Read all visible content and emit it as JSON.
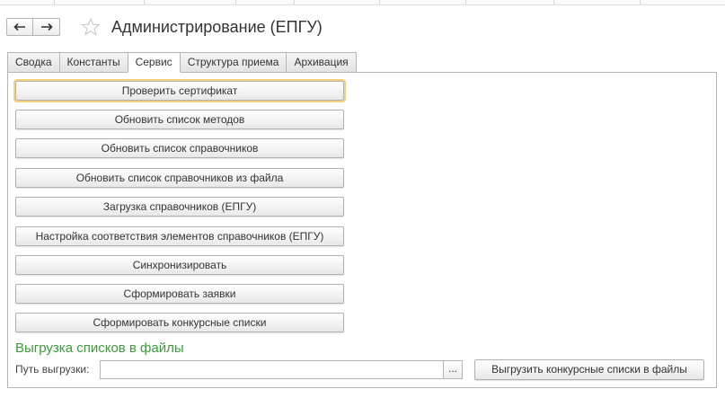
{
  "header": {
    "back_icon": "arrow-left-icon",
    "forward_icon": "arrow-right-icon",
    "favorite_icon": "star-outline-icon",
    "title": "Администрирование (ЕПГУ)"
  },
  "tabs": [
    {
      "label": "Сводка",
      "active": false
    },
    {
      "label": "Константы",
      "active": false
    },
    {
      "label": "Сервис",
      "active": true
    },
    {
      "label": "Структура приема",
      "active": false
    },
    {
      "label": "Архивация",
      "active": false
    }
  ],
  "service": {
    "buttons": [
      {
        "label": "Проверить сертификат",
        "focused": true
      },
      {
        "label": "Обновить список методов",
        "focused": false
      },
      {
        "label": "Обновить список справочников",
        "focused": false
      },
      {
        "label": "Обновить список справочников из файла",
        "focused": false
      },
      {
        "label": "Загрузка справочников (ЕПГУ)",
        "focused": false
      },
      {
        "label": "Настройка соответствия элементов справочников (ЕПГУ)",
        "focused": false
      },
      {
        "label": "Синхронизировать",
        "focused": false
      },
      {
        "label": "Сформировать заявки",
        "focused": false
      },
      {
        "label": "Сформировать конкурсные списки",
        "focused": false
      }
    ],
    "export_section": {
      "title": "Выгрузка списков в файлы",
      "path_label": "Путь выгрузки:",
      "path_value": "",
      "browse_label": "...",
      "export_button": "Выгрузить конкурсные списки в файлы"
    }
  },
  "colors": {
    "section_title": "#3a9a3a",
    "focus_outline": "#f2d27b"
  }
}
